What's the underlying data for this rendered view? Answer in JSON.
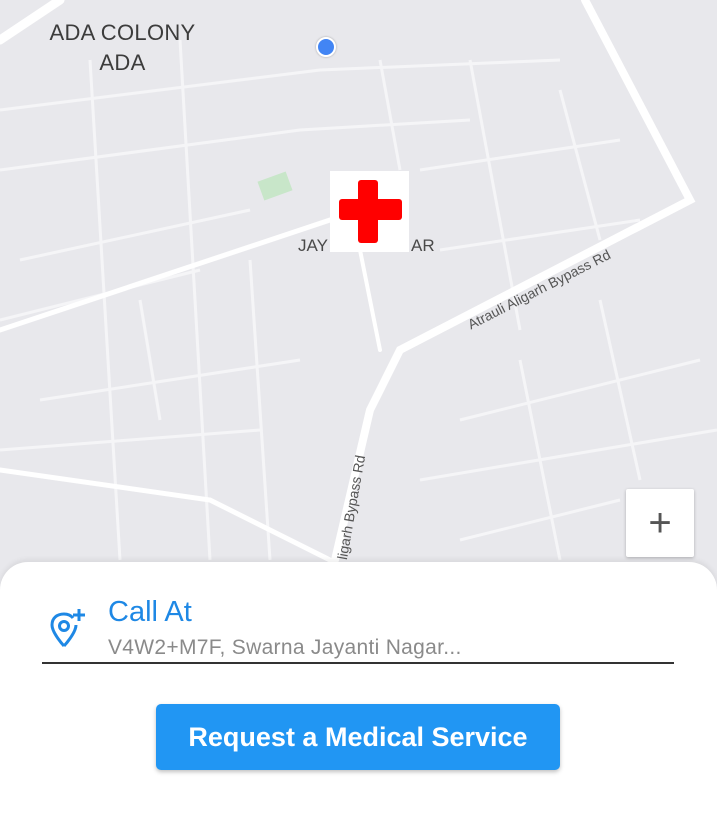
{
  "map": {
    "area_label_line1": "ADA COLONY",
    "area_label_line2": "ADA",
    "locality_left": "JAY",
    "locality_right": "AR",
    "road_label_1": "Atrauli Aligarh Bypass Rd",
    "road_label_2": "ligarh Bypass Rd",
    "marker_icon": "red-cross-icon",
    "zoom_in_label": "+",
    "colors": {
      "background": "#e8e8ec",
      "road": "#ffffff",
      "location_dot": "#4285f4",
      "marker": "#ff0000"
    }
  },
  "sheet": {
    "field_label": "Call At",
    "field_value": "V4W2+M7F, Swarna Jayanti Nagar...",
    "field_icon": "add-location-pin-icon",
    "request_button_label": "Request a Medical Service",
    "colors": {
      "accent": "#2196f3",
      "label": "#1e88e5"
    }
  }
}
